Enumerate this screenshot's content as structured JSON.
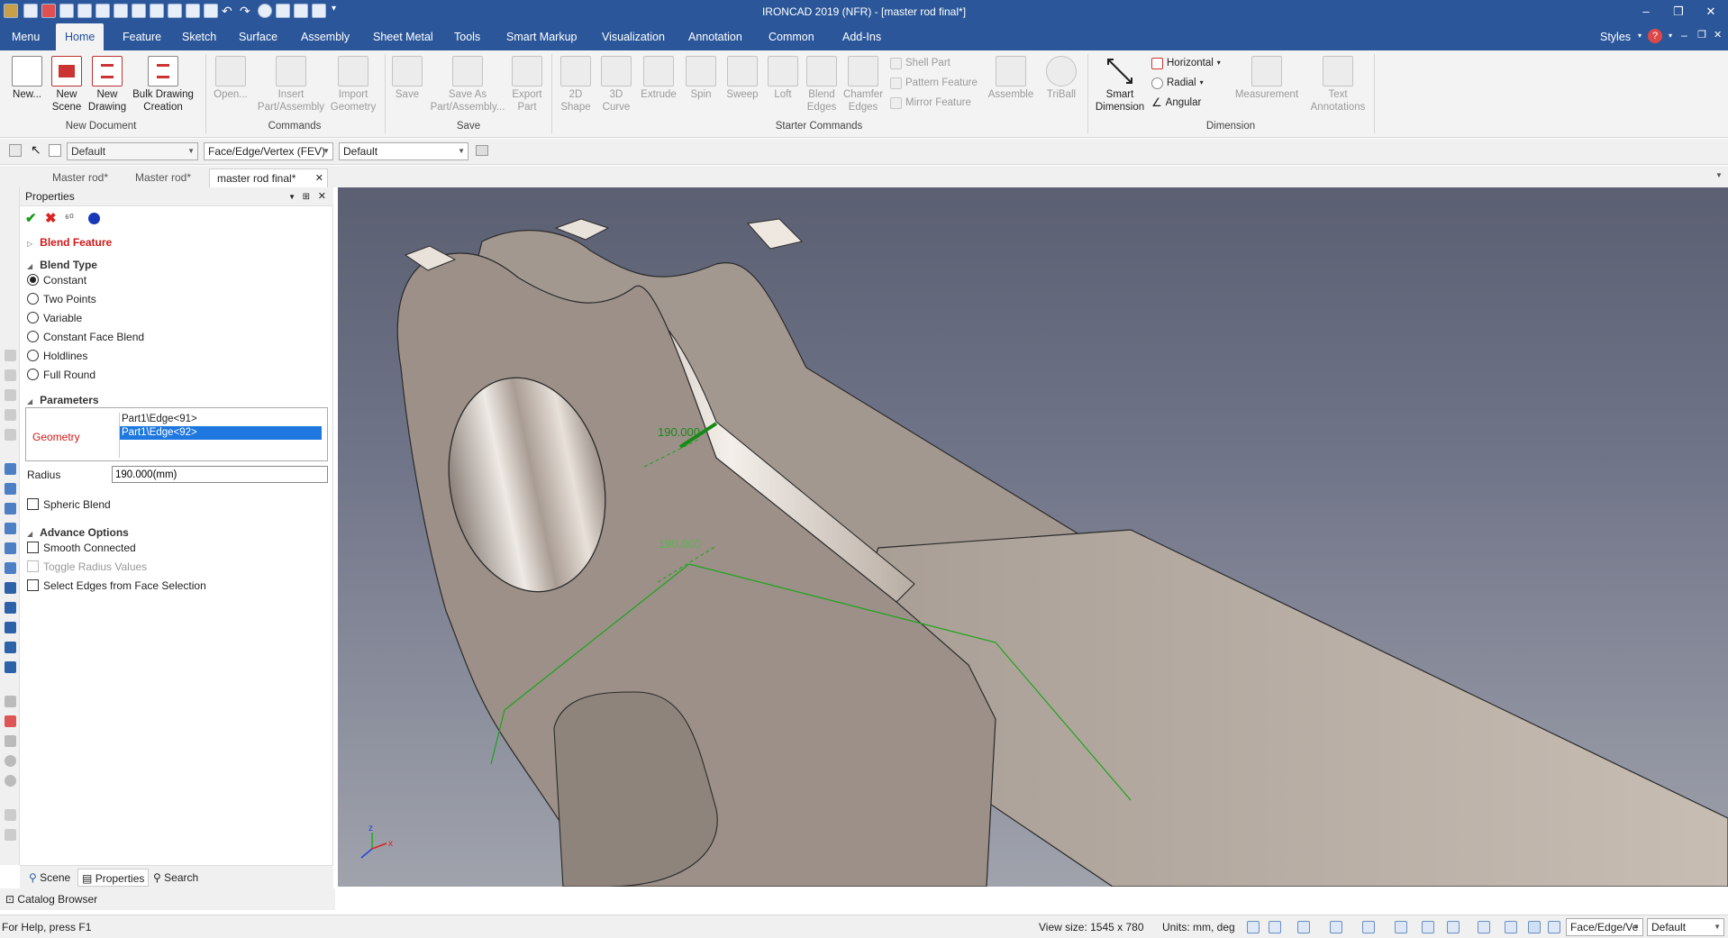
{
  "app": {
    "title": "IRONCAD 2019 (NFR) - [master rod final*]"
  },
  "ribbon_tabs": [
    "Menu",
    "Home",
    "Feature",
    "Sketch",
    "Surface",
    "Assembly",
    "Sheet Metal",
    "Tools",
    "Smart Markup",
    "Visualization",
    "Annotation",
    "Common",
    "Add-Ins"
  ],
  "styles_label": "Styles",
  "ribbon": {
    "new_document": {
      "label": "New Document",
      "buttons": [
        "New...",
        "New Scene",
        "New Drawing",
        "Bulk Drawing Creation"
      ]
    },
    "commands": {
      "label": "Commands",
      "buttons": [
        "Open...",
        "Insert Part/Assembly",
        "Import Geometry"
      ]
    },
    "save": {
      "label": "Save",
      "buttons": [
        "Save",
        "Save As Part/Assembly...",
        "Export Part"
      ]
    },
    "starter": {
      "label": "Starter Commands",
      "buttons": [
        "2D Shape",
        "3D Curve",
        "Extrude",
        "Spin",
        "Sweep",
        "Loft",
        "Blend Edges",
        "Chamfer Edges"
      ],
      "small": [
        "Shell Part",
        "Pattern Feature",
        "Mirror Feature"
      ],
      "buttons2": [
        "Assemble",
        "TriBall"
      ]
    },
    "dimension": {
      "label": "Dimension",
      "smart": "Smart Dimension",
      "small": [
        "Horizontal",
        "Radial",
        "Angular"
      ],
      "buttons": [
        "Measurement",
        "Text Annotations"
      ]
    }
  },
  "toolbar2": {
    "combo1": "Default",
    "combo2": "Face/Edge/Vertex (FEV)",
    "combo3": "Default"
  },
  "doc_tabs": [
    "Master rod*",
    "Master rod*",
    "master rod final*"
  ],
  "properties": {
    "header": "Properties",
    "feature_title": "Blend Feature",
    "blend_type_label": "Blend Type",
    "blend_types": [
      "Constant",
      "Two Points",
      "Variable",
      "Constant Face Blend",
      "Holdlines",
      "Full Round"
    ],
    "parameters_label": "Parameters",
    "geometry_label": "Geometry",
    "geometry_items": [
      "Part1\\Edge<91>",
      "Part1\\Edge<92>"
    ],
    "radius_label": "Radius",
    "radius_value": "190.000(mm)",
    "spheric_blend": "Spheric Blend",
    "advance_label": "Advance Options",
    "advance_options": [
      "Smooth Connected",
      "Toggle Radius Values",
      "Select Edges from Face Selection"
    ]
  },
  "panel_tabs": [
    "Scene",
    "Properties",
    "Search"
  ],
  "catalog_browser": "Catalog Browser",
  "viewport": {
    "dim_label_1": "190.000",
    "dim_label_2": "190.000",
    "axis_x": "x",
    "axis_z": "z"
  },
  "status": {
    "help": "For Help, press F1",
    "view_size": "View size: 1545 x 780",
    "units": "Units: mm, deg",
    "combo1": "Face/Edge/Ve",
    "combo2": "Default"
  }
}
